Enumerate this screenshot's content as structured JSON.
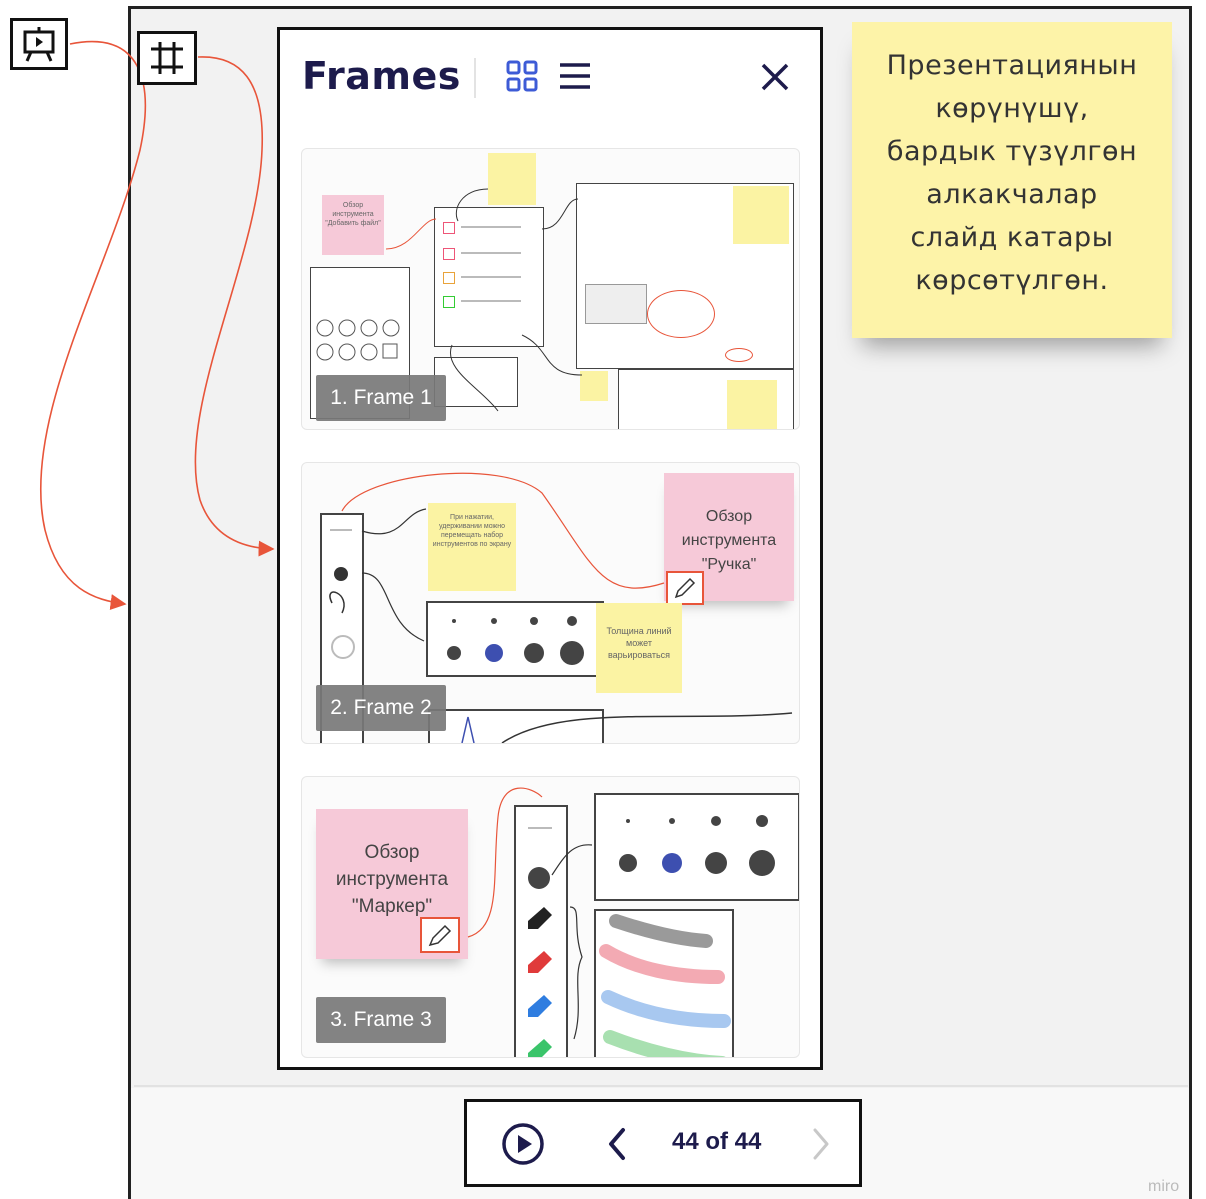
{
  "toolbar": {
    "presentation_icon": "presentation-easel-icon",
    "frames_icon": "frames-grid-icon"
  },
  "panel": {
    "title": "Frames",
    "grid_view_icon": "grid-view-icon",
    "list_view_icon": "list-view-icon",
    "close_icon": "close-icon"
  },
  "frames": [
    {
      "label": "1. Frame 1",
      "content": {
        "pink_note": "Обзор инструмента \"Добавить файл\""
      }
    },
    {
      "label": "2. Frame 2",
      "content": {
        "pink_note": "Обзор инструмента \"Ручка\"",
        "yellow_note_1": "При нажатии, удерживании можно перемещать набор инструментов по экрану",
        "yellow_note_2": "Толщина линий может варьироваться"
      }
    },
    {
      "label": "3. Frame 3",
      "content": {
        "pink_note": "Обзор инструмента \"Маркер\""
      }
    }
  ],
  "sticky_note": {
    "lines": [
      "Презентациянын",
      "көрүнүшү,",
      "бардык түзүлгөн",
      "алкакчалар",
      "слайд катары",
      "көрсөтүлгөн."
    ]
  },
  "navigation": {
    "play_icon": "play-icon",
    "prev_icon": "chevron-left-icon",
    "counter": "44 of 44",
    "next_icon": "chevron-right-icon"
  },
  "watermark": "miro",
  "colors": {
    "accent": "#3d5bd6",
    "title": "#1d1b4c",
    "connector": "#e8553a",
    "sticky_yellow": "#fdf3a8",
    "sticky_pink": "#f6c9d8"
  }
}
